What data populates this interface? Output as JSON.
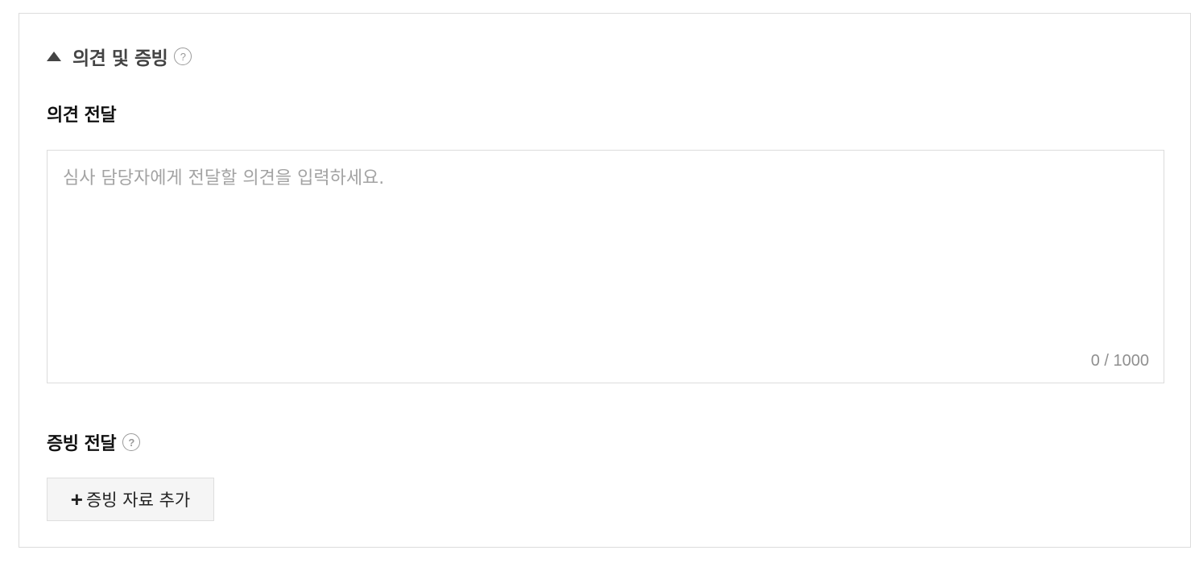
{
  "section": {
    "title": "의견 및 증빙",
    "toggle_icon": "triangle-up-icon",
    "help_icon": "?"
  },
  "opinion": {
    "label": "의견 전달",
    "placeholder": "심사 담당자에게 전달할 의견을 입력하세요.",
    "value": "",
    "counter": "0 / 1000"
  },
  "evidence": {
    "label": "증빙 전달",
    "help_icon": "?",
    "add_button": {
      "icon": "+",
      "label": "증빙 자료 추가"
    }
  },
  "colors": {
    "border": "#dcdcdc",
    "title_text": "#444444",
    "placeholder": "#a3a3a3",
    "button_bg": "#f5f5f5"
  }
}
